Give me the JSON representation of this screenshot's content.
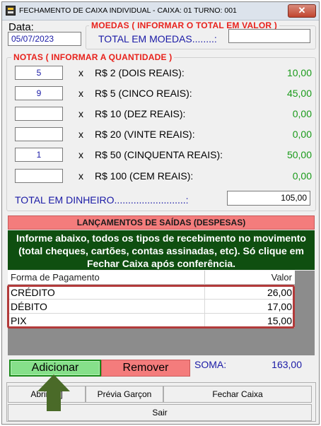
{
  "window": {
    "title": "FECHAMENTO DE CAIXA INDIVIDUAL - CAIXA: 01 TURNO: 001",
    "close_label": "✕"
  },
  "date": {
    "label": "Data:",
    "value": "05/07/2023"
  },
  "moedas": {
    "group_title": "MOEDAS  ( INFORMAR O TOTAL EM VALOR )",
    "total_label": "TOTAL EM MOEDAS........:",
    "total_value": ""
  },
  "notas": {
    "group_title": "NOTAS ( INFORMAR A QUANTIDADE )",
    "times": "x",
    "rows": [
      {
        "qty": "5",
        "desc": "R$ 2 (DOIS REAIS):",
        "value": "10,00"
      },
      {
        "qty": "9",
        "desc": "R$ 5 (CINCO REAIS):",
        "value": "45,00"
      },
      {
        "qty": "",
        "desc": "R$ 10 (DEZ REAIS):",
        "value": "0,00"
      },
      {
        "qty": "",
        "desc": "R$ 20 (VINTE REAIS):",
        "value": "0,00"
      },
      {
        "qty": "1",
        "desc": "R$ 50 (CINQUENTA REAIS):",
        "value": "50,00"
      },
      {
        "qty": "",
        "desc": "R$ 100 (CEM REAIS):",
        "value": "0,00"
      }
    ],
    "total_label": "TOTAL EM DINHEIRO..........................:",
    "total_value": "105,00"
  },
  "saidas": {
    "banner": "LANÇAMENTOS DE SAÍDAS (DESPESAS)",
    "info": "Informe abaixo, todos os tipos de recebimento no movimento (total cheques, cartões, contas assinadas, etc). Só clique em Fechar Caixa após conferência."
  },
  "grid": {
    "col_forma": "Forma de Pagamento",
    "col_valor": "Valor",
    "rows": [
      {
        "forma": "CRÉDITO",
        "valor": "26,00"
      },
      {
        "forma": "DÉBITO",
        "valor": "17,00"
      },
      {
        "forma": "PIX",
        "valor": "15,00"
      }
    ]
  },
  "actions": {
    "add_label": "Adicionar",
    "remove_label": "Remover",
    "soma_label": "SOMA:",
    "soma_value": "163,00"
  },
  "bottom": {
    "abrir_label": "Abrir [...]",
    "previa_label": "Prévia Garçon",
    "fechar_label": "Fechar Caixa",
    "sair_label": "Sair"
  },
  "colors": {
    "group_title": "#e8221c",
    "value_green": "#1a9a1a",
    "field_blue": "#1a1aa6",
    "banner_red": "#f47c7c",
    "info_green": "#0f4f10",
    "highlight": "#b23a3a",
    "arrow": "#4a6a28"
  }
}
